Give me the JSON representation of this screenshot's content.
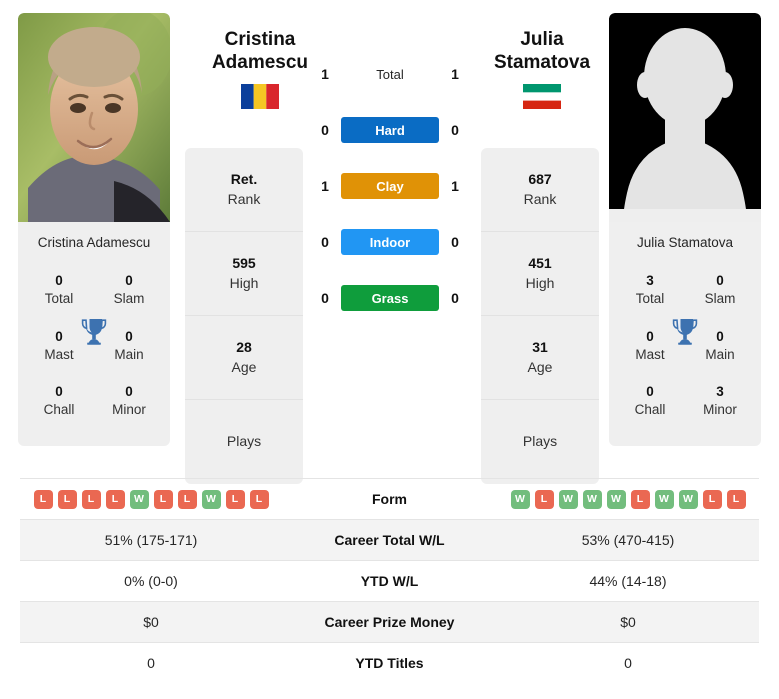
{
  "players": {
    "left": {
      "first_name": "Cristina",
      "last_name": "Adamescu",
      "full_name": "Cristina Adamescu",
      "photo_caption": "Cristina Adamescu",
      "country": "Romania",
      "flag_icon": "flag-romania",
      "flag_colors": [
        "#0b3f9b",
        "#f5c623",
        "#d9262c"
      ],
      "rank": "Ret.",
      "rank_label": "Rank",
      "high": "595",
      "high_label": "High",
      "age": "28",
      "age_label": "Age",
      "plays": "",
      "plays_label": "Plays",
      "titles": [
        {
          "num": "0",
          "label": "Total"
        },
        {
          "num": "0",
          "label": "Slam"
        },
        {
          "num": "0",
          "label": "Mast"
        },
        {
          "num": "0",
          "label": "Main"
        },
        {
          "num": "0",
          "label": "Chall"
        },
        {
          "num": "0",
          "label": "Minor"
        }
      ],
      "form": [
        "L",
        "L",
        "L",
        "L",
        "W",
        "L",
        "L",
        "W",
        "L",
        "L"
      ]
    },
    "right": {
      "first_name": "Julia",
      "last_name": "Stamatova",
      "full_name": "Julia Stamatova",
      "photo_caption": "Julia Stamatova",
      "country": "Bulgaria",
      "flag_icon": "flag-bulgaria",
      "flag_colors": [
        "#00966e",
        "#ffffff",
        "#d62612"
      ],
      "rank": "687",
      "rank_label": "Rank",
      "high": "451",
      "high_label": "High",
      "age": "31",
      "age_label": "Age",
      "plays": "",
      "plays_label": "Plays",
      "titles": [
        {
          "num": "3",
          "label": "Total"
        },
        {
          "num": "0",
          "label": "Slam"
        },
        {
          "num": "0",
          "label": "Mast"
        },
        {
          "num": "0",
          "label": "Main"
        },
        {
          "num": "0",
          "label": "Chall"
        },
        {
          "num": "3",
          "label": "Minor"
        }
      ],
      "form": [
        "W",
        "L",
        "W",
        "W",
        "W",
        "L",
        "W",
        "W",
        "L",
        "L"
      ]
    }
  },
  "head_to_head": {
    "rows": [
      {
        "label": "Total",
        "left": "1",
        "right": "1",
        "color": "",
        "pill": false
      },
      {
        "label": "Hard",
        "left": "0",
        "right": "0",
        "color": "#0a6cc4",
        "pill": true
      },
      {
        "label": "Clay",
        "left": "1",
        "right": "1",
        "color": "#e09206",
        "pill": true
      },
      {
        "label": "Indoor",
        "left": "0",
        "right": "0",
        "color": "#2196f3",
        "pill": true
      },
      {
        "label": "Grass",
        "left": "0",
        "right": "0",
        "color": "#0f9d3c",
        "pill": true
      }
    ]
  },
  "trophy_icon": "trophy-icon",
  "stats_table": {
    "form_label": "Form",
    "rows": [
      {
        "label": "Career Total W/L",
        "left": "51% (175-171)",
        "right": "53% (470-415)",
        "shaded": true
      },
      {
        "label": "YTD W/L",
        "left": "0% (0-0)",
        "right": "44% (14-18)",
        "shaded": false
      },
      {
        "label": "Career Prize Money",
        "left": "$0",
        "right": "$0",
        "shaded": true
      },
      {
        "label": "YTD Titles",
        "left": "0",
        "right": "0",
        "shaded": false
      }
    ]
  },
  "colors": {
    "badge_win": "#72bd7d",
    "badge_loss": "#ea6852",
    "card_bg": "#efefef",
    "row_shade": "#f3f3f3",
    "trophy": "#3d72b0"
  }
}
